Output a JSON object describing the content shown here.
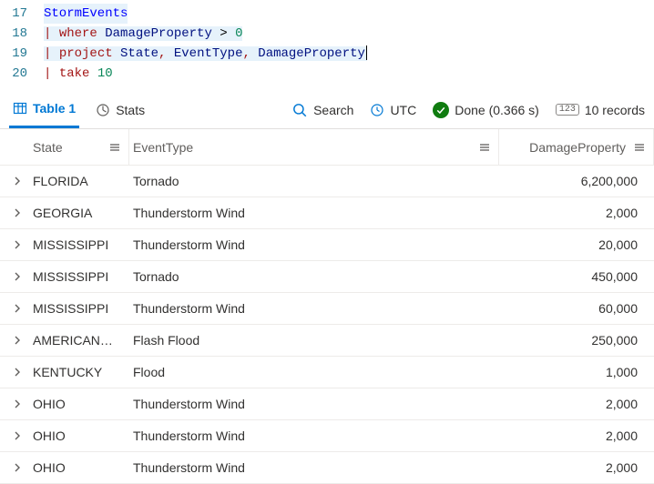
{
  "editor": {
    "lines": [
      {
        "num": "17",
        "tokens": [
          {
            "t": "StormEvents",
            "c": "tok-table",
            "sel": true
          }
        ]
      },
      {
        "num": "18",
        "sel": true,
        "tokens": [
          {
            "t": "| ",
            "c": "tok-pipe"
          },
          {
            "t": "where",
            "c": "tok-keyword"
          },
          {
            "t": " ",
            "c": ""
          },
          {
            "t": "DamageProperty",
            "c": "tok-col"
          },
          {
            "t": " > ",
            "c": "tok-op"
          },
          {
            "t": "0",
            "c": "tok-num"
          }
        ]
      },
      {
        "num": "19",
        "sel": true,
        "cursor": true,
        "tokens": [
          {
            "t": "| ",
            "c": "tok-pipe"
          },
          {
            "t": "project",
            "c": "tok-keyword"
          },
          {
            "t": " ",
            "c": ""
          },
          {
            "t": "State",
            "c": "tok-col"
          },
          {
            "t": ", ",
            "c": "tok-punct"
          },
          {
            "t": "EventType",
            "c": "tok-col"
          },
          {
            "t": ", ",
            "c": "tok-punct"
          },
          {
            "t": "DamageProperty",
            "c": "tok-col"
          }
        ]
      },
      {
        "num": "20",
        "tokens": [
          {
            "t": "| ",
            "c": "tok-pipe"
          },
          {
            "t": "take",
            "c": "tok-keyword"
          },
          {
            "t": " ",
            "c": ""
          },
          {
            "t": "10",
            "c": "tok-num"
          }
        ]
      }
    ]
  },
  "toolbar": {
    "table_tab": "Table 1",
    "stats_tab": "Stats",
    "search": "Search",
    "utc": "UTC",
    "status": "Done (0.366 s)",
    "records": "10 records",
    "count_badge": "123"
  },
  "columns": {
    "state": "State",
    "event": "EventType",
    "damage": "DamageProperty"
  },
  "rows": [
    {
      "state": "FLORIDA",
      "event": "Tornado",
      "damage": "6,200,000"
    },
    {
      "state": "GEORGIA",
      "event": "Thunderstorm Wind",
      "damage": "2,000"
    },
    {
      "state": "MISSISSIPPI",
      "event": "Thunderstorm Wind",
      "damage": "20,000"
    },
    {
      "state": "MISSISSIPPI",
      "event": "Tornado",
      "damage": "450,000"
    },
    {
      "state": "MISSISSIPPI",
      "event": "Thunderstorm Wind",
      "damage": "60,000"
    },
    {
      "state": "AMERICAN…",
      "event": "Flash Flood",
      "damage": "250,000"
    },
    {
      "state": "KENTUCKY",
      "event": "Flood",
      "damage": "1,000"
    },
    {
      "state": "OHIO",
      "event": "Thunderstorm Wind",
      "damage": "2,000"
    },
    {
      "state": "OHIO",
      "event": "Thunderstorm Wind",
      "damage": "2,000"
    },
    {
      "state": "OHIO",
      "event": "Thunderstorm Wind",
      "damage": "2,000"
    }
  ]
}
